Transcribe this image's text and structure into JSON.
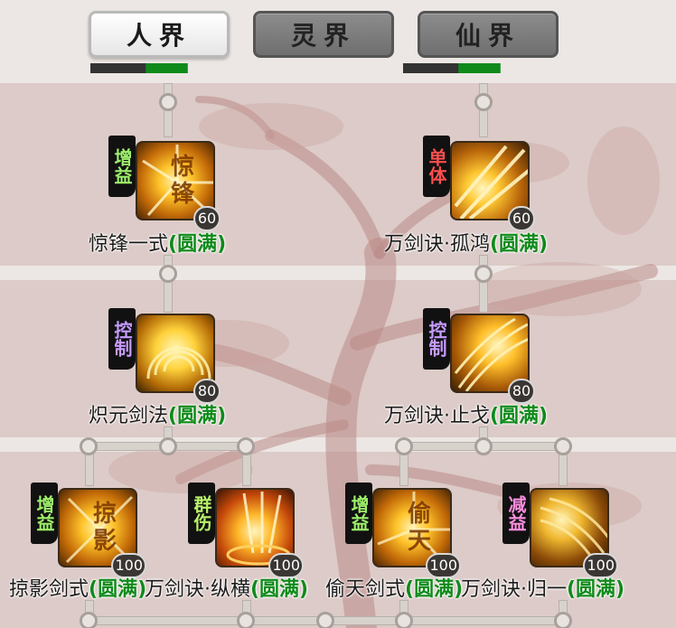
{
  "tabs": [
    {
      "label": "人界",
      "active": true
    },
    {
      "label": "灵界",
      "active": false
    },
    {
      "label": "仙界",
      "active": false
    }
  ],
  "colors": {
    "status": "#0f8a1a",
    "tag_green": "#9ef06a",
    "tag_red": "#ff4f4f",
    "tag_purple": "#c79bff",
    "tag_pink": "#ff8fe0"
  },
  "skills": [
    {
      "name": "惊锋一式",
      "status": "(圆满)",
      "level": "60",
      "tag": "增益",
      "glyph": "惊锋",
      "icon": "sword-burst-icon"
    },
    {
      "name": "万剑诀·孤鸿",
      "status": "(圆满)",
      "level": "60",
      "tag": "单体",
      "glyph": "",
      "icon": "sword-strike-icon"
    },
    {
      "name": "炽元剑法",
      "status": "(圆满)",
      "level": "80",
      "tag": "控制",
      "glyph": "",
      "icon": "golden-dome-icon"
    },
    {
      "name": "万剑诀·止戈",
      "status": "(圆满)",
      "level": "80",
      "tag": "控制",
      "glyph": "",
      "icon": "sword-slash-icon"
    },
    {
      "name": "掠影剑式",
      "status": "(圆满)",
      "level": "100",
      "tag": "增益",
      "glyph": "掠影",
      "icon": "shadow-sword-icon"
    },
    {
      "name": "万剑诀·纵横",
      "status": "(圆满)",
      "level": "100",
      "tag": "群伤",
      "glyph": "",
      "icon": "sword-rain-icon"
    },
    {
      "name": "偷天剑式",
      "status": "(圆满)",
      "level": "100",
      "tag": "增益",
      "glyph": "偷天",
      "icon": "sky-sword-icon"
    },
    {
      "name": "万剑诀·归一",
      "status": "(圆满)",
      "level": "100",
      "tag": "减益",
      "glyph": "",
      "icon": "unity-sword-icon"
    }
  ]
}
